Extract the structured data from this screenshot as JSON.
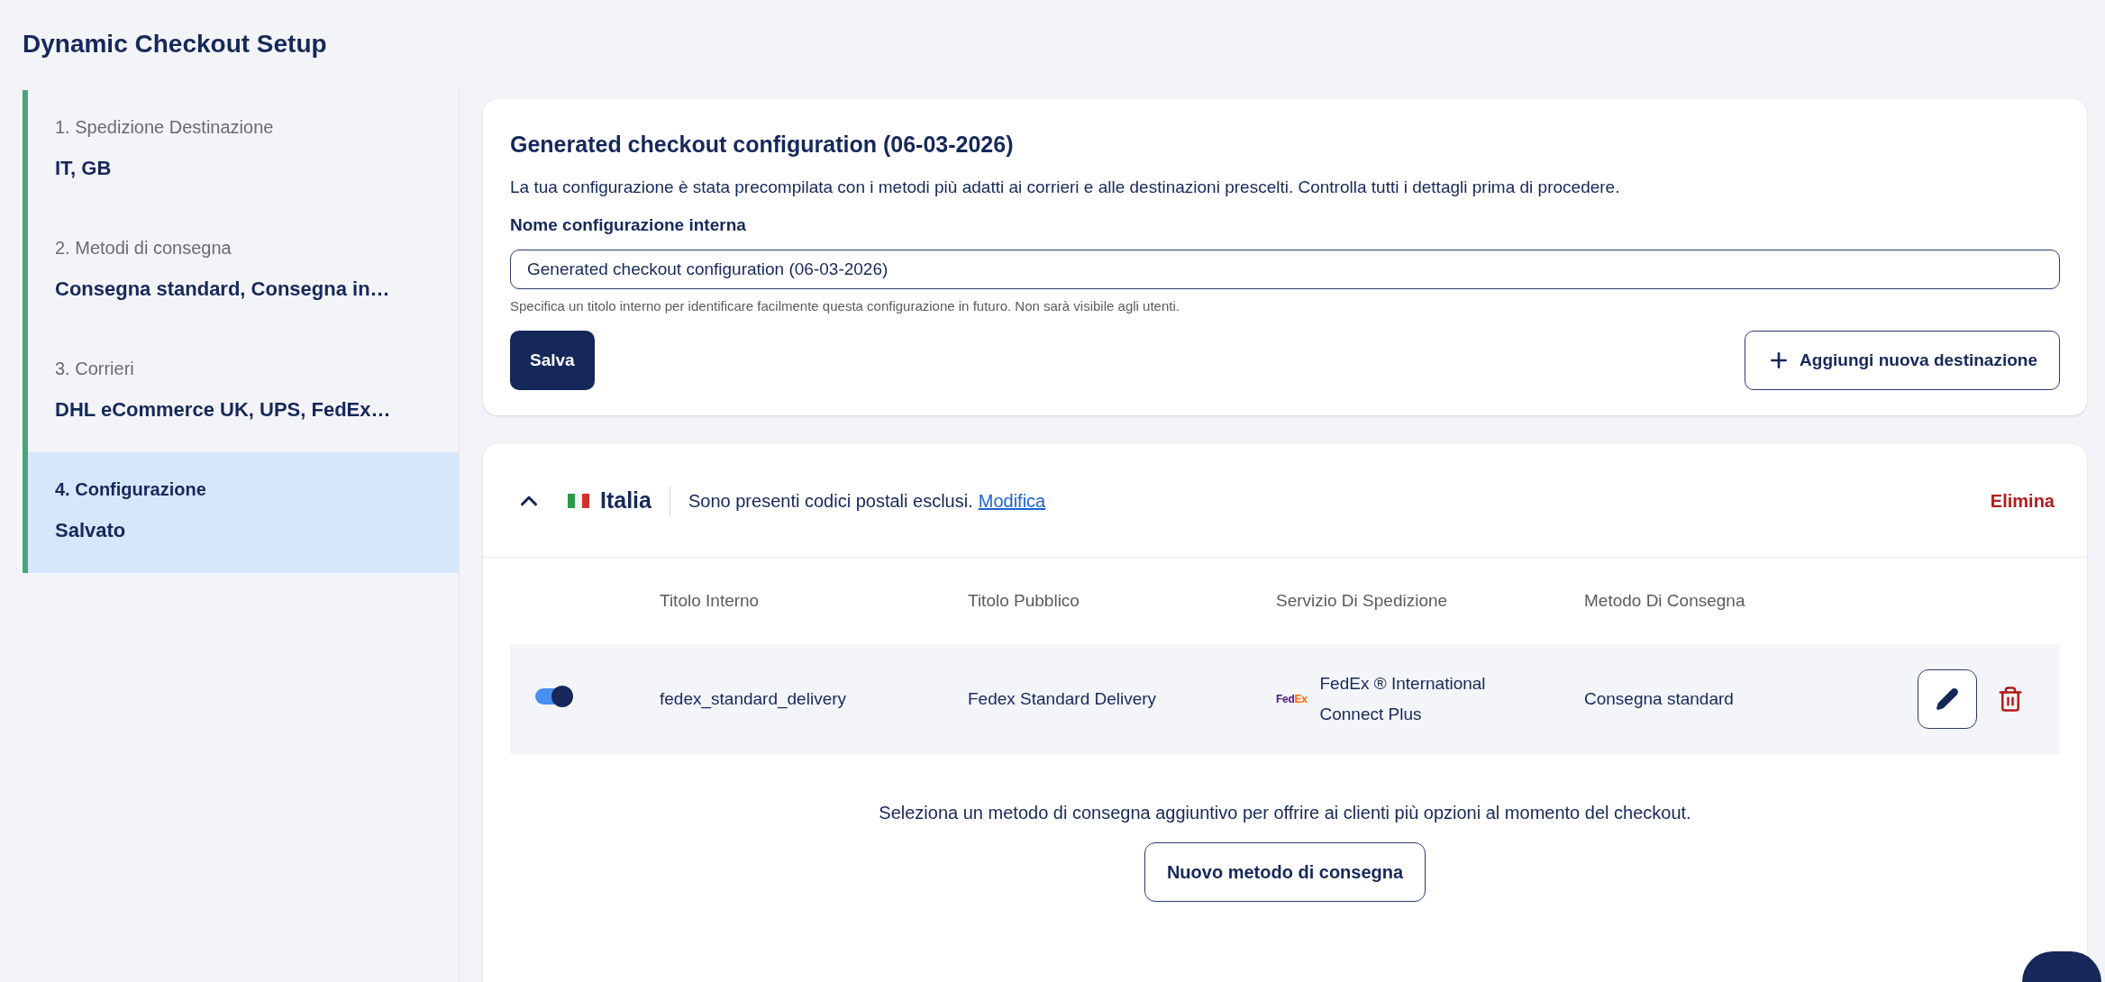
{
  "page": {
    "title": "Dynamic Checkout Setup"
  },
  "steps": [
    {
      "label": "1. Spedizione Destinazione",
      "value": "IT, GB",
      "selected": false
    },
    {
      "label": "2. Metodi di consegna",
      "value": "Consegna standard, Consegna in…",
      "selected": false
    },
    {
      "label": "3. Corrieri",
      "value": "DHL eCommerce UK, UPS, FedEx…",
      "selected": false
    },
    {
      "label": "4. Configurazione",
      "value": "Salvato",
      "selected": true
    }
  ],
  "config_card": {
    "title": "Generated checkout configuration (06-03-2026)",
    "description": "La tua configurazione è stata precompilata con i metodi più adatti ai corrieri e alle destinazioni prescelti. Controlla tutti i dettagli prima di procedere.",
    "field_label": "Nome configurazione interna",
    "field_value": "Generated checkout configuration (06-03-2026)",
    "field_help": "Specifica un titolo interno per identificare facilmente questa configurazione in futuro. Non sarà visibile agli utenti.",
    "save_button": "Salva",
    "add_button": "Aggiungi nuova destinazione"
  },
  "destination": {
    "expanded": true,
    "country": "Italia",
    "notice": "Sono presenti codici postali esclusi.",
    "notice_link": "Modifica",
    "delete": "Elimina",
    "columns": [
      "Titolo Interno",
      "Titolo Pubblico",
      "Servizio Di Spedizione",
      "Metodo Di Consegna"
    ],
    "rows": [
      {
        "on": true,
        "internal_title": "fedex_standard_delivery",
        "public_title": "Fedex Standard Delivery",
        "carrier_logo": "FedEx",
        "service": "FedEx ® International Connect Plus",
        "method": "Consegna standard"
      }
    ],
    "footer_text": "Seleziona un metodo di consegna aggiuntivo per offrire ai clienti più opzioni al momento del checkout.",
    "footer_button": "Nuovo metodo di consegna"
  }
}
